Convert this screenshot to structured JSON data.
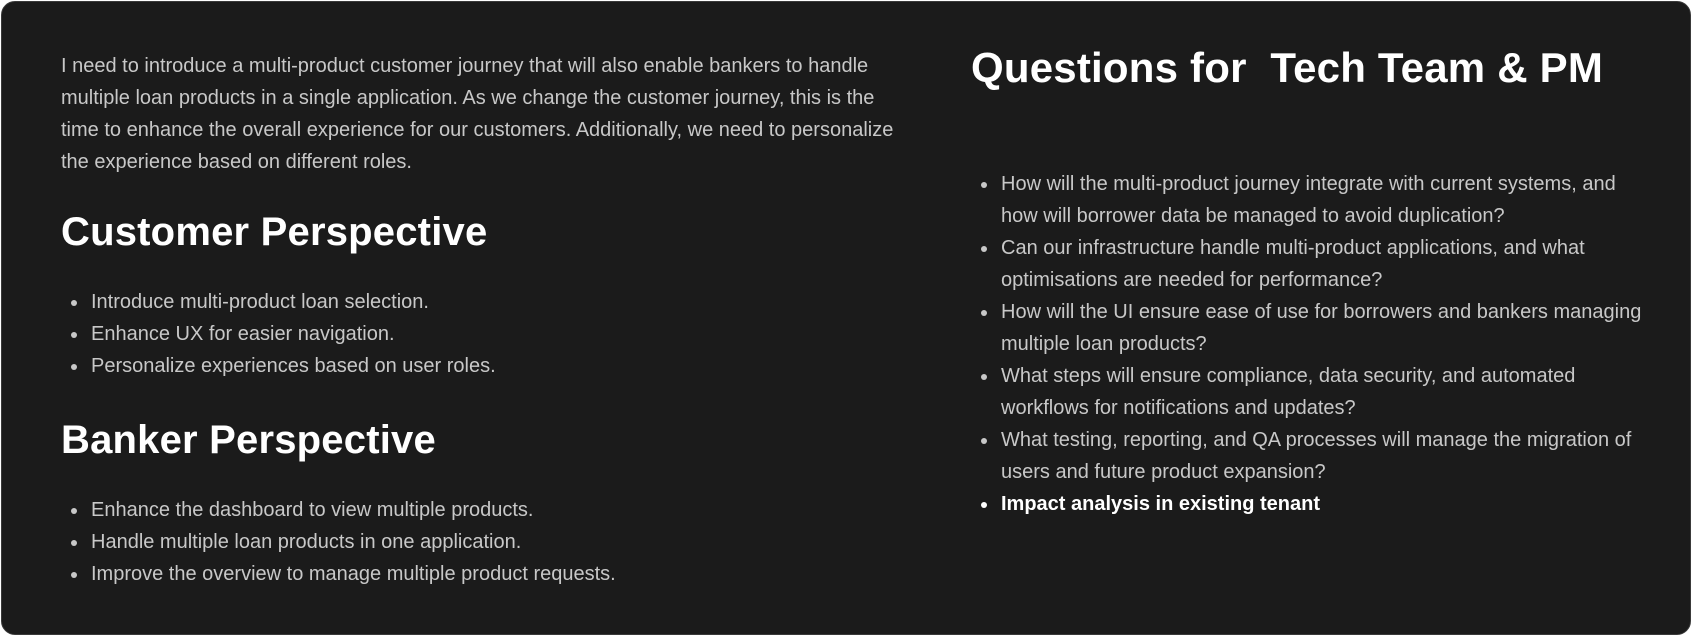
{
  "intro": "I need to introduce a multi-product customer journey that will also enable bankers to handle multiple loan products in a single application. As we change the customer journey, this is the time to enhance the overall experience for our customers. Additionally, we need to personalize the experience based on different roles.",
  "customer": {
    "title": "Customer Perspective",
    "items": [
      "Introduce multi-product loan selection.",
      "Enhance UX for easier navigation.",
      "Personalize experiences based on user roles."
    ]
  },
  "banker": {
    "title": "Banker Perspective",
    "items": [
      "Enhance the dashboard to view multiple products.",
      "Handle multiple loan products in one application.",
      "Improve the overview to manage multiple product requests."
    ]
  },
  "questions": {
    "title": "Questions for  Tech Team & PM",
    "items": [
      "How will the multi-product journey integrate with current systems, and how will borrower data be managed to avoid duplication?",
      "Can our infrastructure handle multi-product applications, and what optimisations are needed for performance?",
      "How will the UI ensure ease of use for borrowers and bankers managing multiple loan products?",
      "What steps will ensure compliance, data security, and automated workflows for notifications and updates?",
      "What testing, reporting, and QA processes will manage the migration of users and future product expansion?",
      "Impact analysis in existing tenant"
    ]
  }
}
